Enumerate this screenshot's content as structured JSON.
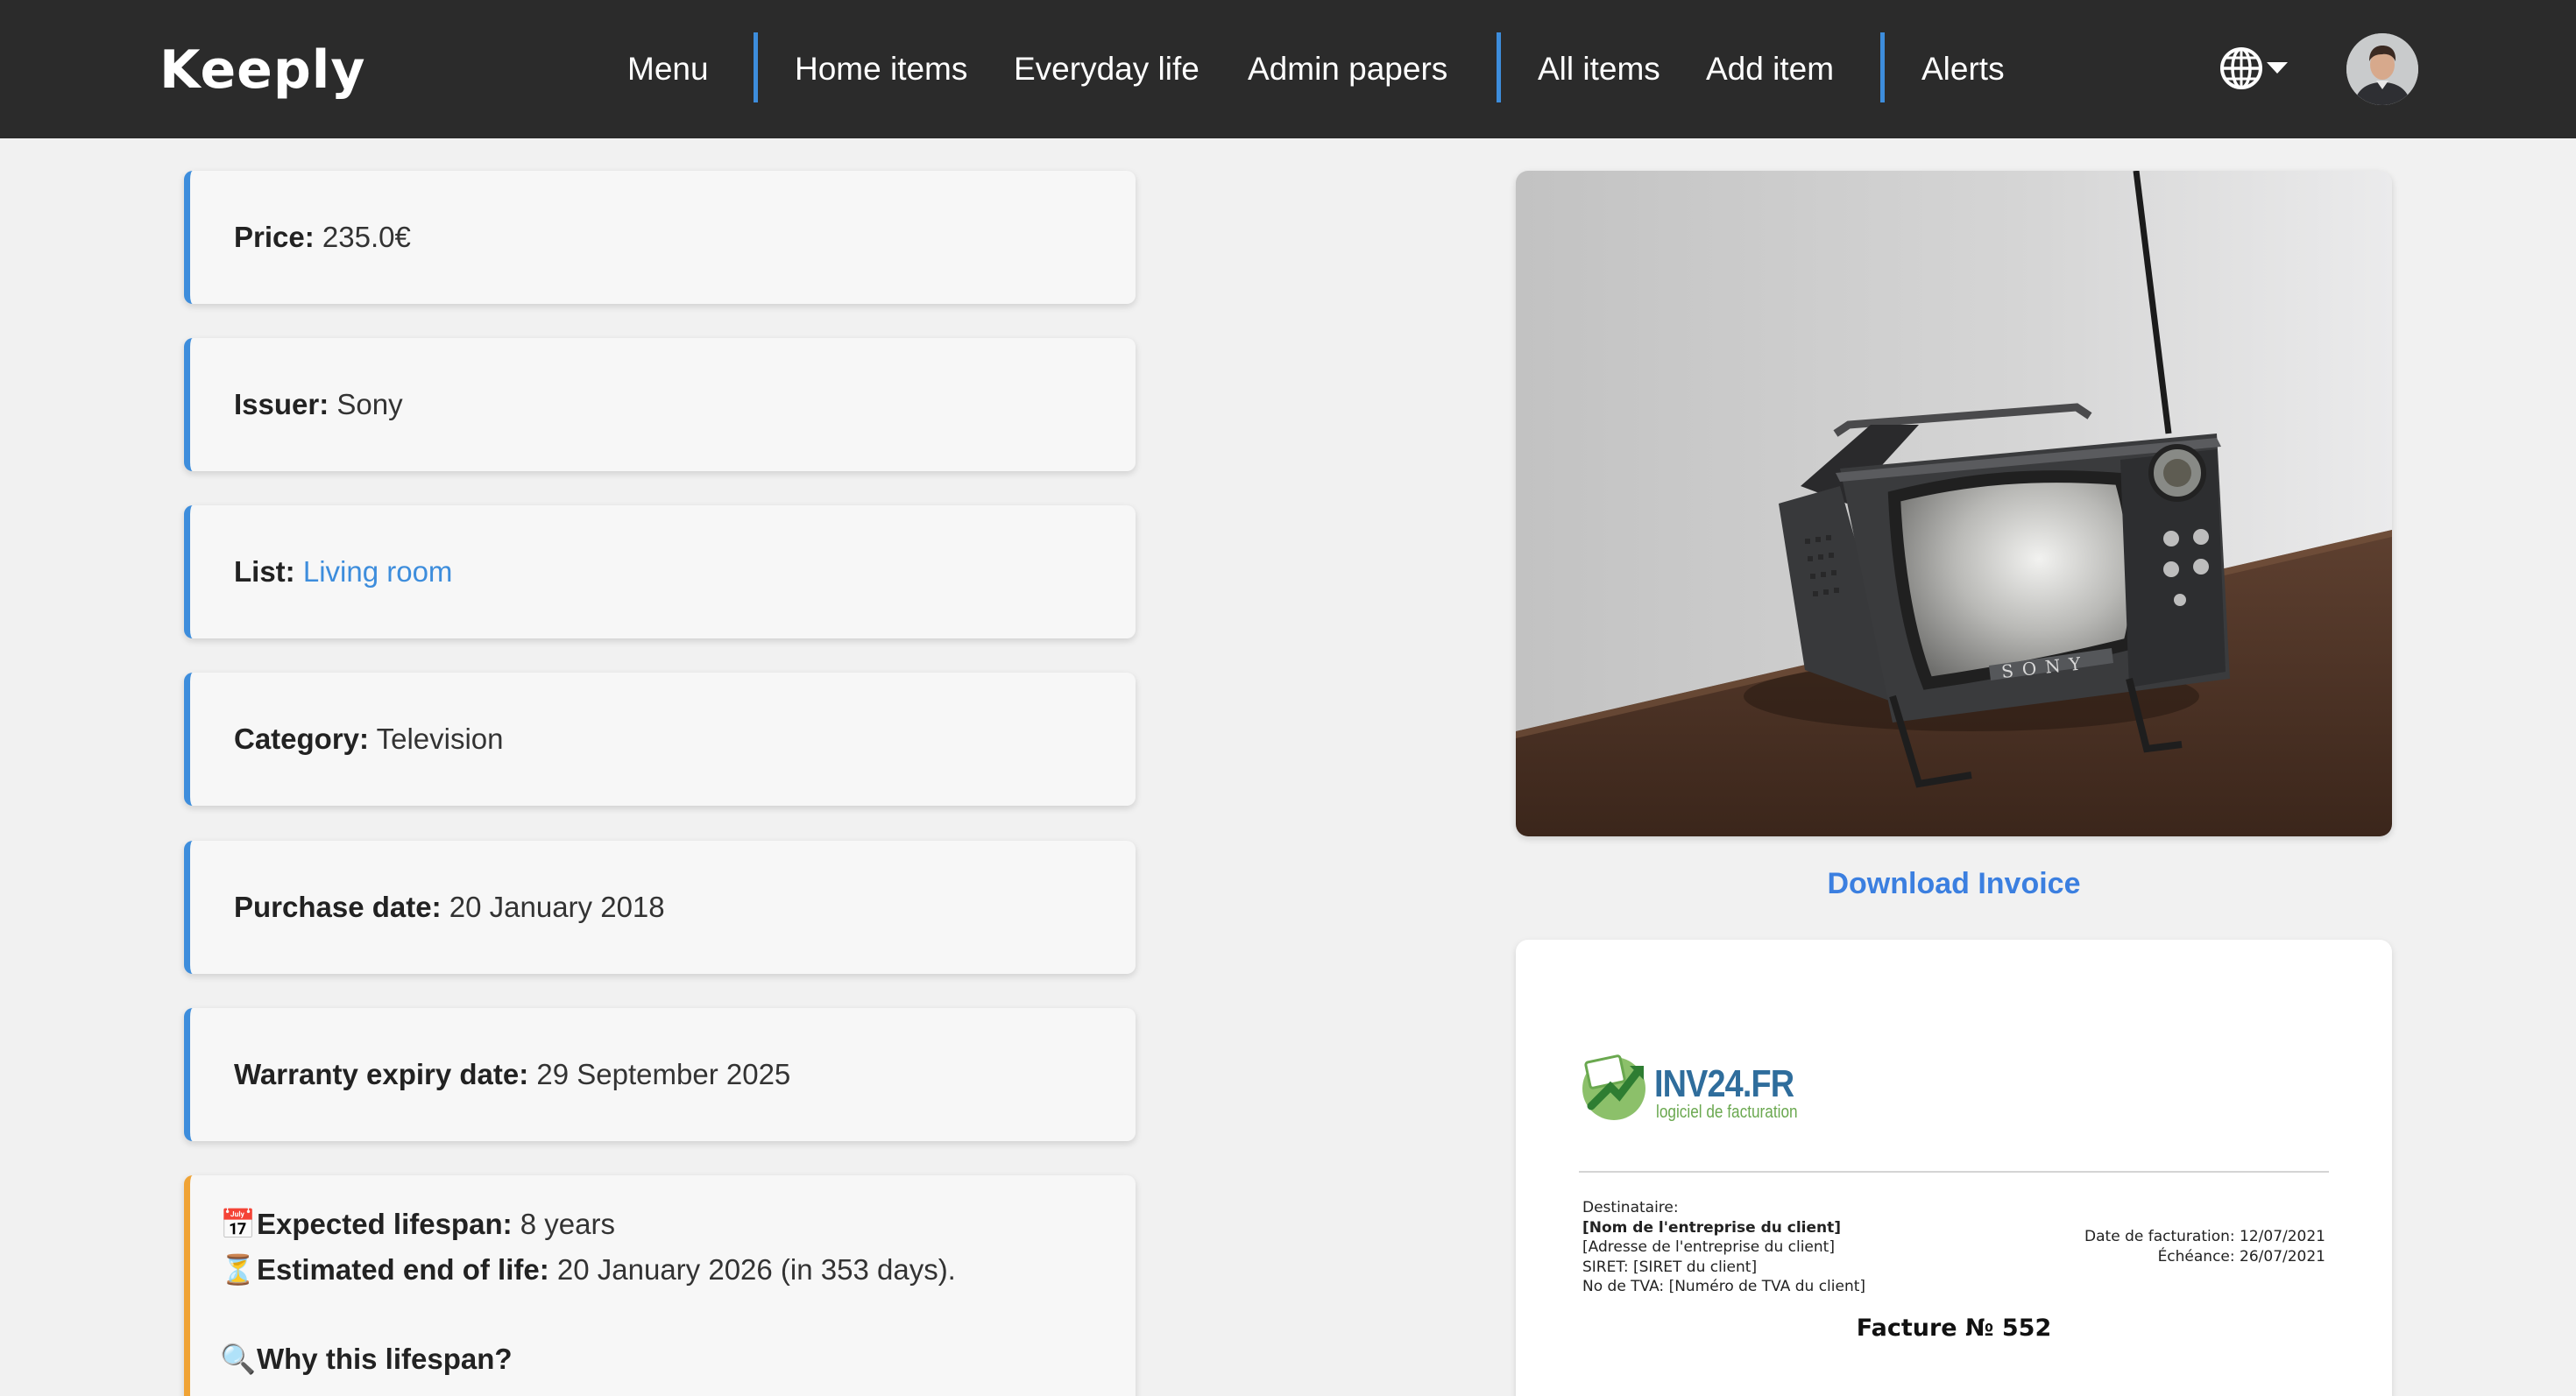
{
  "header": {
    "logo": "Keeply",
    "nav": {
      "menu": "Menu",
      "home_items": "Home items",
      "everyday_life": "Everyday life",
      "admin_papers": "Admin papers",
      "all_items": "All items",
      "add_item": "Add item",
      "alerts": "Alerts"
    },
    "language_icon": "globe-icon",
    "accent_color": "#3d8ddc",
    "background_color": "#2b2b2b"
  },
  "details": {
    "price": {
      "label": "Price:",
      "value": "235.0€"
    },
    "issuer": {
      "label": "Issuer:",
      "value": "Sony"
    },
    "list": {
      "label": "List:",
      "value": "Living room"
    },
    "category": {
      "label": "Category:",
      "value": "Television"
    },
    "purchase_date": {
      "label": "Purchase date:",
      "value": "20 January 2018"
    },
    "warranty": {
      "label": "Warranty expiry date:",
      "value": "29 September 2025"
    }
  },
  "lifespan": {
    "expected_icon": "📅",
    "expected_label": "Expected lifespan:",
    "expected_value": "8 years",
    "end_icon": "⏳",
    "end_label": "Estimated end of life:",
    "end_value": "20 January 2026 (in 353 days).",
    "why_icon": "🔍",
    "why_label": "Why this lifespan?",
    "accent_color": "#f0a335"
  },
  "photo": {
    "tv_brand": "SONY"
  },
  "invoice": {
    "download_label": "Download Invoice",
    "brand": "INV24.FR",
    "tagline": "logiciel de facturation",
    "recipient_label": "Destinataire:",
    "company_name": "[Nom de l'entreprise du client]",
    "company_address": "[Adresse de l'entreprise du client]",
    "siret": "SIRET: [SIRET du client]",
    "vat": "No de TVA: [Numéro de TVA du client]",
    "invoice_date": "Date de facturation: 12/07/2021",
    "due_date": "Échéance: 26/07/2021",
    "title": "Facture № 552"
  }
}
